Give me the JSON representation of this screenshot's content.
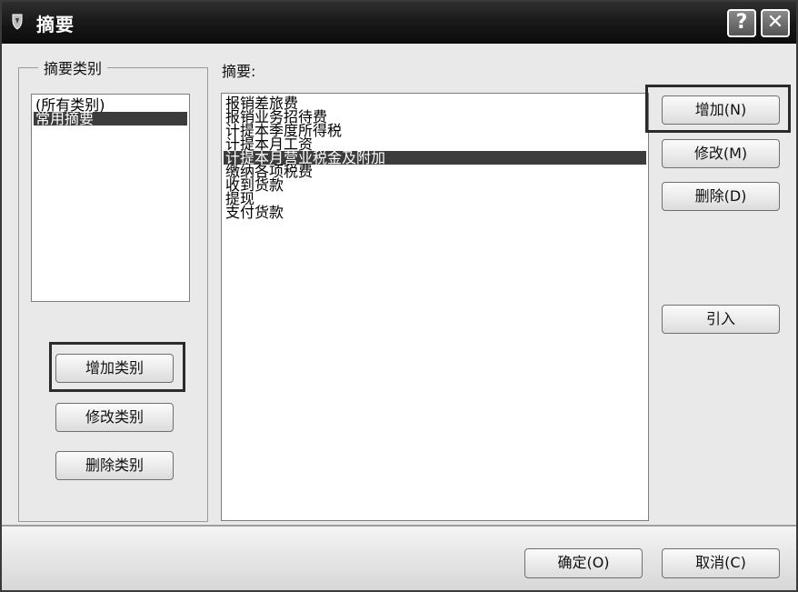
{
  "window": {
    "title": "摘要",
    "help_glyph": "?",
    "close_glyph": "✕"
  },
  "categories": {
    "group_label": "摘要类别",
    "items": [
      {
        "label": "(所有类别)",
        "selected": false
      },
      {
        "label": "常用摘要",
        "selected": true
      }
    ],
    "add_button": "增加类别",
    "edit_button": "修改类别",
    "delete_button": "删除类别"
  },
  "summaries": {
    "label": "摘要:",
    "items": [
      {
        "label": "报销差旅费",
        "selected": false
      },
      {
        "label": "报销业务招待费",
        "selected": false
      },
      {
        "label": "计提本季度所得税",
        "selected": false
      },
      {
        "label": "计提本月工资",
        "selected": false
      },
      {
        "label": "计提本月营业税金及附加",
        "selected": true
      },
      {
        "label": "缴纳各项税费",
        "selected": false
      },
      {
        "label": "收到货款",
        "selected": false
      },
      {
        "label": "提现",
        "selected": false
      },
      {
        "label": "支付货款",
        "selected": false
      }
    ]
  },
  "actions": {
    "add": "增加(N)",
    "edit": "修改(M)",
    "delete": "删除(D)",
    "import": "引入"
  },
  "footer": {
    "ok": "确定(O)",
    "cancel": "取消(C)"
  }
}
